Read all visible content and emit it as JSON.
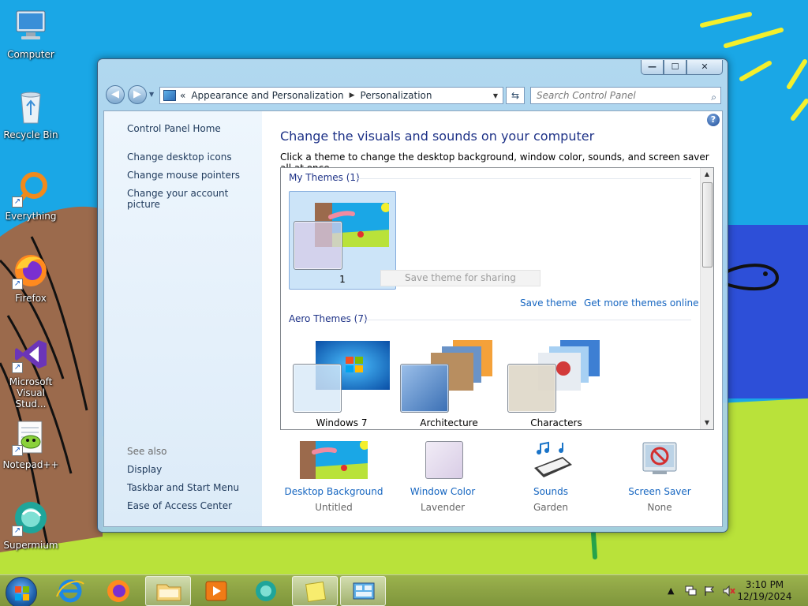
{
  "desktop": {
    "icons": [
      {
        "label": "Computer",
        "icon": "computer-icon"
      },
      {
        "label": "Recycle Bin",
        "icon": "recycle-bin-icon"
      },
      {
        "label": "Everything",
        "icon": "everything-icon"
      },
      {
        "label": "Firefox",
        "icon": "firefox-icon"
      },
      {
        "label": "Microsoft Visual Stud...",
        "icon": "visual-studio-icon"
      },
      {
        "label": "Notepad++",
        "icon": "notepad-plus-plus-icon"
      },
      {
        "label": "Supermium",
        "icon": "supermium-icon"
      }
    ]
  },
  "window": {
    "caption_buttons": {
      "minimize": "—",
      "maximize": "☐",
      "close": "✕"
    },
    "nav": {
      "back": "◀",
      "forward": "▶",
      "breadcrumb_overflow": "«",
      "breadcrumb": [
        "Appearance and Personalization",
        "Personalization"
      ],
      "search_placeholder": "Search Control Panel"
    },
    "left_pane": {
      "home": "Control Panel Home",
      "links": [
        "Change desktop icons",
        "Change mouse pointers",
        "Change your account picture"
      ],
      "see_also_heading": "See also",
      "see_also": [
        "Display",
        "Taskbar and Start Menu",
        "Ease of Access Center"
      ]
    },
    "main": {
      "title": "Change the visuals and sounds on your computer",
      "description": "Click a theme to change the desktop background, window color, sounds, and screen saver all at once.",
      "my_themes_heading": "My Themes (1)",
      "my_themes": [
        {
          "name": "1",
          "selected": true
        }
      ],
      "save_sharing": "Save theme for sharing",
      "save_theme": "Save theme",
      "get_more": "Get more themes online",
      "aero_heading": "Aero Themes (7)",
      "aero_themes": [
        {
          "name": "Windows 7"
        },
        {
          "name": "Architecture"
        },
        {
          "name": "Characters"
        }
      ],
      "bottom": [
        {
          "label": "Desktop Background",
          "value": "Untitled"
        },
        {
          "label": "Window Color",
          "value": "Lavender"
        },
        {
          "label": "Sounds",
          "value": "Garden"
        },
        {
          "label": "Screen Saver",
          "value": "None"
        }
      ]
    }
  },
  "taskbar": {
    "apps": [
      "internet-explorer-icon",
      "firefox-icon",
      "file-explorer-icon",
      "media-player-icon",
      "supermium-icon",
      "sticky-notes-icon",
      "control-panel-icon"
    ],
    "tray": {
      "show_hidden": "▲"
    },
    "time": "3:10 PM",
    "date": "12/19/2024"
  },
  "colors": {
    "link": "#1565c0",
    "heading": "#1e3287",
    "selected_tile": "#cce4f8",
    "desktop_blue": "#1aa7e6",
    "desktop_green": "#b9e23a"
  }
}
